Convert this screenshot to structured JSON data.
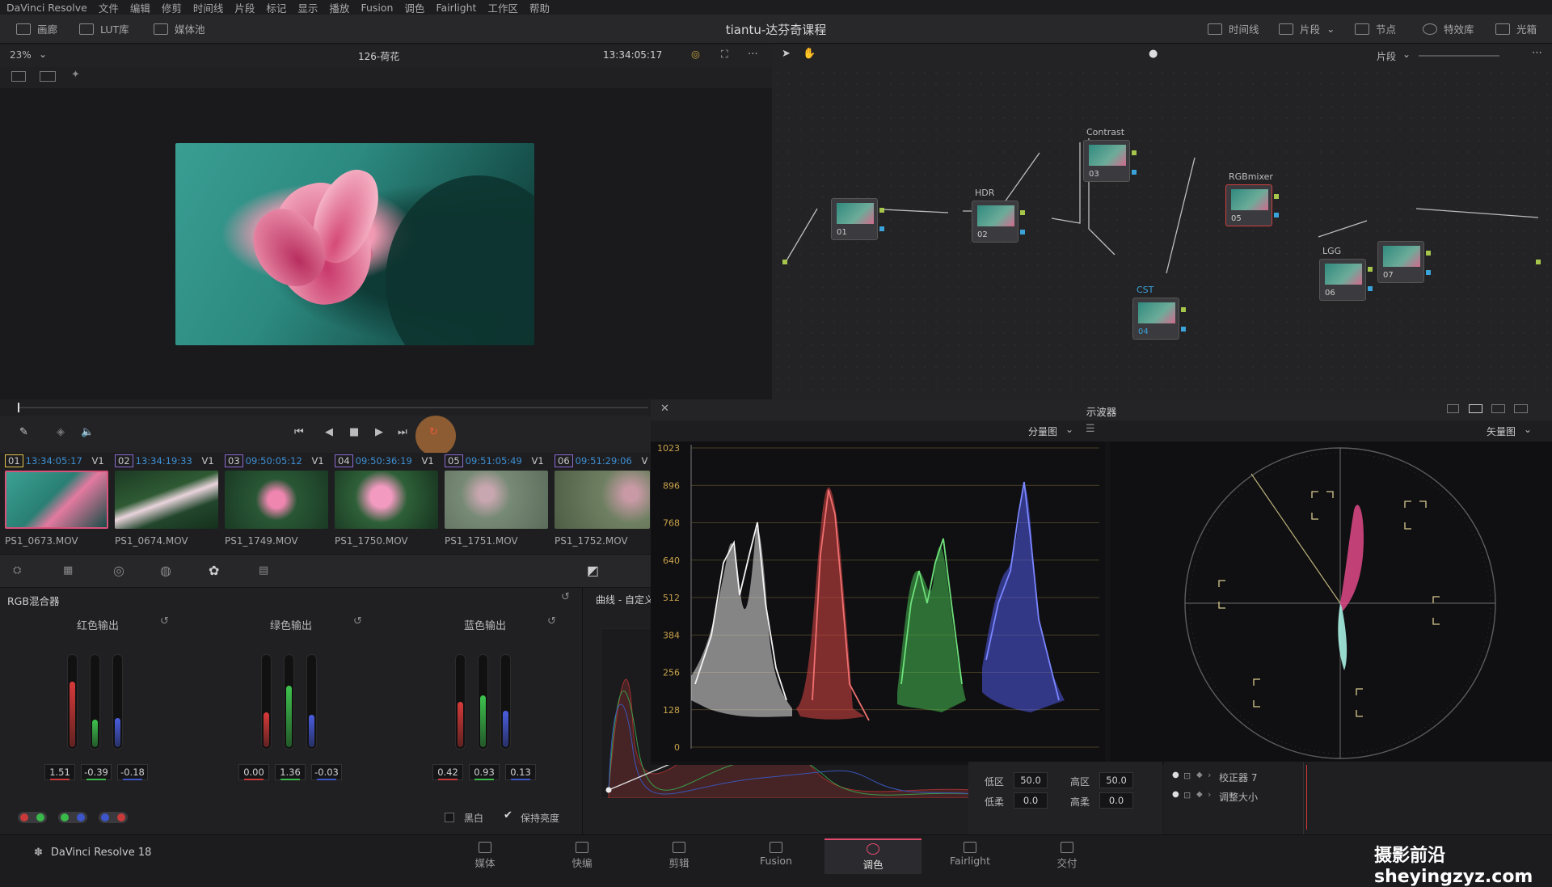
{
  "menu": [
    "DaVinci Resolve",
    "文件",
    "编辑",
    "修剪",
    "时间线",
    "片段",
    "标记",
    "显示",
    "播放",
    "Fusion",
    "调色",
    "Fairlight",
    "工作区",
    "帮助"
  ],
  "toolbar": {
    "left": [
      {
        "label": "画廊",
        "icon": "gallery-icon"
      },
      {
        "label": "LUT库",
        "icon": "lut-icon"
      },
      {
        "label": "媒体池",
        "icon": "media-pool-icon"
      }
    ],
    "title": "tiantu-达芬奇课程",
    "right": [
      {
        "label": "时间线",
        "icon": "timeline-icon"
      },
      {
        "label": "片段",
        "icon": "clips-icon"
      },
      {
        "label": "节点",
        "icon": "nodes-icon"
      },
      {
        "label": "特效库",
        "icon": "fx-icon"
      },
      {
        "label": "光箱",
        "icon": "lightbox-icon"
      }
    ]
  },
  "viewer": {
    "zoom": "23%",
    "clip_name": "126-荷花",
    "timecode": "13:34:05:17",
    "node_mode": "片段"
  },
  "nodes": [
    {
      "id": "01",
      "label": ""
    },
    {
      "id": "02",
      "label": "HDR"
    },
    {
      "id": "03",
      "label": "Contrast"
    },
    {
      "id": "04",
      "label": "CST"
    },
    {
      "id": "05",
      "label": "RGBmixer"
    },
    {
      "id": "06",
      "label": "LGG"
    },
    {
      "id": "07",
      "label": ""
    }
  ],
  "clips": [
    {
      "num": "01",
      "tc": "13:34:05:17",
      "track": "V1",
      "name": "PS1_0673.MOV"
    },
    {
      "num": "02",
      "tc": "13:34:19:33",
      "track": "V1",
      "name": "PS1_0674.MOV"
    },
    {
      "num": "03",
      "tc": "09:50:05:12",
      "track": "V1",
      "name": "PS1_1749.MOV"
    },
    {
      "num": "04",
      "tc": "09:50:36:19",
      "track": "V1",
      "name": "PS1_1750.MOV"
    },
    {
      "num": "05",
      "tc": "09:51:05:49",
      "track": "V1",
      "name": "PS1_1751.MOV"
    },
    {
      "num": "06",
      "tc": "09:51:29:06",
      "track": "V",
      "name": "PS1_1752.MOV"
    }
  ],
  "mixer": {
    "title": "RGB混合器",
    "groups": [
      {
        "label": "红色输出",
        "values": [
          "1.51",
          "-0.39",
          "-0.18"
        ],
        "levels": [
          0.72,
          0.3,
          0.32
        ]
      },
      {
        "label": "绿色输出",
        "values": [
          "0.00",
          "1.36",
          "-0.03"
        ],
        "levels": [
          0.38,
          0.68,
          0.36
        ]
      },
      {
        "label": "蓝色输出",
        "values": [
          "0.42",
          "0.93",
          "0.13"
        ],
        "levels": [
          0.5,
          0.57,
          0.4
        ]
      }
    ],
    "monochrome": "黑白",
    "preserve_luminance": "保持亮度"
  },
  "curves": {
    "title": "曲线 - 自定义"
  },
  "scope": {
    "title": "示波器",
    "left_mode": "分量图",
    "right_mode": "矢量图",
    "ticks": [
      "1023",
      "896",
      "768",
      "640",
      "512",
      "384",
      "256",
      "128",
      "0"
    ]
  },
  "adjust": {
    "low_label": "低区",
    "low_value": "50.0",
    "high_label": "高区",
    "high_value": "50.0",
    "low_soft_label": "低柔",
    "low_soft_value": "0.0",
    "high_soft_label": "高柔",
    "high_soft_value": "0.0"
  },
  "keyframes": [
    "校正器 7",
    "调整大小"
  ],
  "pages": [
    {
      "label": "媒体",
      "icon": "media-icon"
    },
    {
      "label": "快编",
      "icon": "cut-icon"
    },
    {
      "label": "剪辑",
      "icon": "edit-icon"
    },
    {
      "label": "Fusion",
      "icon": "fusion-icon"
    },
    {
      "label": "调色",
      "icon": "color-icon",
      "active": true
    },
    {
      "label": "Fairlight",
      "icon": "fairlight-icon"
    },
    {
      "label": "交付",
      "icon": "deliver-icon"
    }
  ],
  "app_name": "DaVinci Resolve 18",
  "watermark": "摄影前沿 sheyingzyz.com"
}
